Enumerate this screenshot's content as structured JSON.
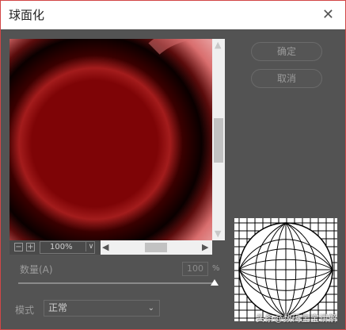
{
  "dialog": {
    "title": "球面化",
    "close_label": "✕",
    "buttons": {
      "ok": "确定",
      "cancel": "取消"
    }
  },
  "preview": {
    "zoom_value": "100%",
    "zoom_out_label": "−",
    "zoom_in_label": "+",
    "zoom_dropdown_icon": "∨",
    "scroll_up_icon": "▲",
    "scroll_down_icon": "▼",
    "scroll_left_icon": "◀",
    "scroll_right_icon": "▶"
  },
  "amount": {
    "label": "数量(A)",
    "value": "100",
    "unit": "%",
    "level": 1.0
  },
  "mode": {
    "label": "模式",
    "selected": "正常",
    "chevron": "⌄"
  },
  "watermark": "头条@数码宝宝讲解"
}
